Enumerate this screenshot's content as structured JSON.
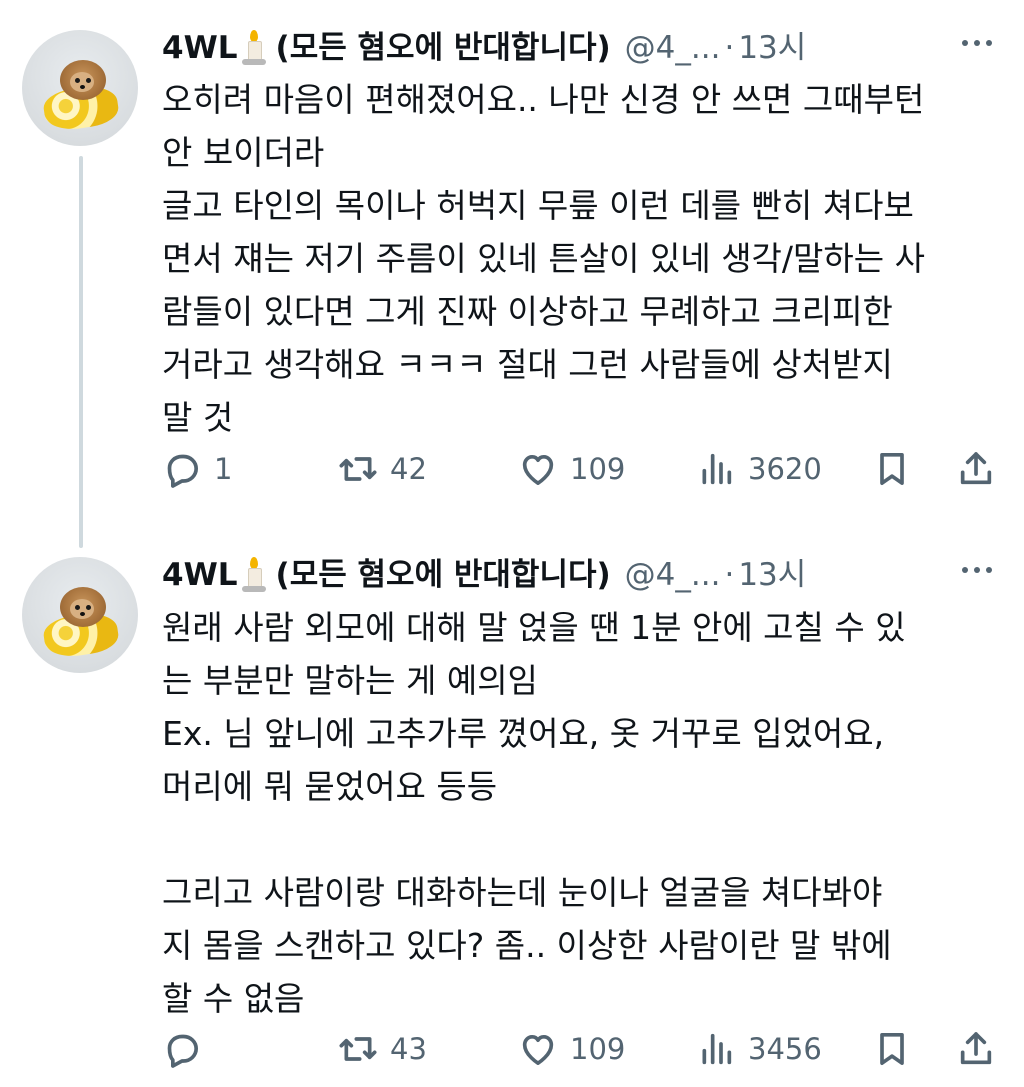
{
  "tweets": [
    {
      "display_name": "4WL",
      "name_suffix": "(모든 혐오에 반대합니다)",
      "handle": "@4_...",
      "separator": "·",
      "time": "13시",
      "text": "오히려 마음이 편해졌어요.. 나만 신경 안 쓰면 그때부턴\n안 보이더라\n글고 타인의 목이나 허벅지 무릎 이런 데를 빤히 쳐다보\n면서 쟤는 저기 주름이 있네 튼살이 있네 생각/말하는 사\n람들이 있다면 그게 진짜 이상하고 무례하고 크리피한\n거라고 생각해요 ㅋㅋㅋ 절대 그런 사람들에 상처받지\n말 것",
      "replies": "1",
      "retweets": "42",
      "likes": "109",
      "views": "3620"
    },
    {
      "display_name": "4WL",
      "name_suffix": "(모든 혐오에 반대합니다)",
      "handle": "@4_...",
      "separator": "·",
      "time": "13시",
      "text": "원래 사람 외모에 대해 말 얹을 땐 1분 안에 고칠 수 있\n는 부분만 말하는 게 예의임\nEx. 님 앞니에 고추가루 꼈어요, 옷 거꾸로 입었어요,\n머리에 뭐 묻었어요 등등\n\n그리고 사람이랑 대화하는데 눈이나 얼굴을 쳐다봐야\n지 몸을 스캔하고 있다? 좀.. 이상한 사람이란 말 밖에\n할 수 없음",
      "replies": "",
      "retweets": "43",
      "likes": "109",
      "views": "3456"
    }
  ],
  "icons": {
    "avatar": "pomeranian-on-yellow-cushion",
    "emoji": "candle-icon",
    "more": "more-icon",
    "reply": "reply-icon",
    "retweet": "retweet-icon",
    "like": "heart-icon",
    "views": "views-icon",
    "bookmark": "bookmark-icon",
    "share": "share-icon"
  },
  "colors": {
    "text": "#0f1419",
    "secondary": "#536471",
    "thread_line": "#cfd9de",
    "background": "#ffffff"
  }
}
